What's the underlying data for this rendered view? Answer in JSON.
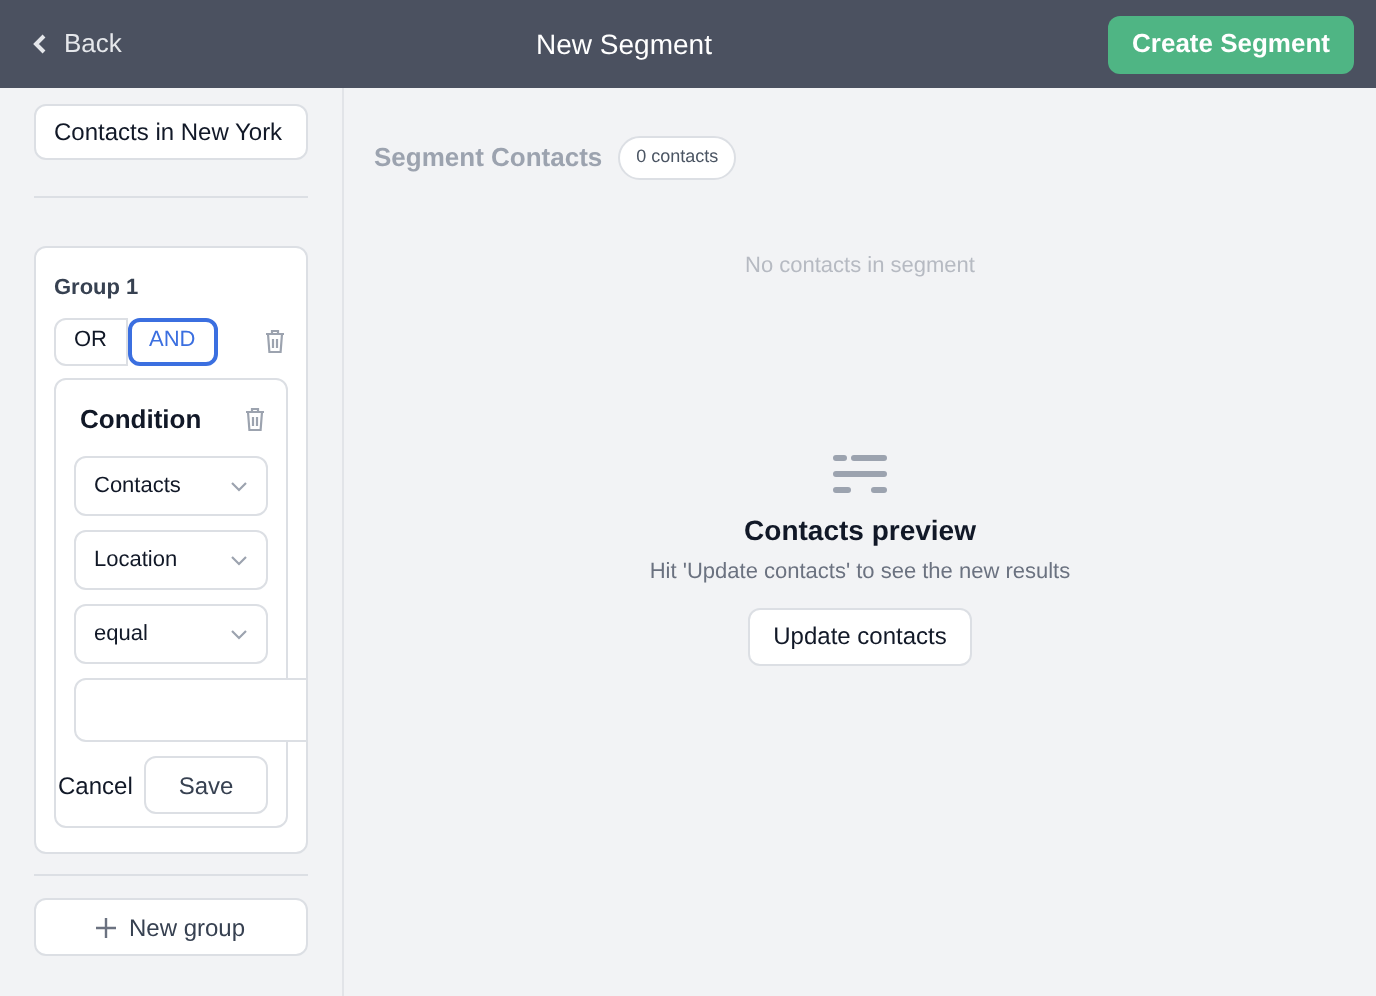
{
  "header": {
    "back": "Back",
    "title": "New Segment",
    "action": "Create Segment"
  },
  "sidebar": {
    "segment_name": "Contacts in New York",
    "group": {
      "title": "Group 1",
      "operators": [
        {
          "label": "OR",
          "selected": false
        },
        {
          "label": "AND",
          "selected": true
        }
      ],
      "condition": {
        "title": "Condition",
        "selects": [
          "Contacts",
          "Location",
          "equal"
        ],
        "cancel": "Cancel",
        "save": "Save"
      }
    },
    "new_group": "New group"
  },
  "main": {
    "title": "Segment Contacts",
    "count": "0 contacts",
    "empty": "No contacts in segment",
    "preview_title": "Contacts preview",
    "preview_hint": "Hit 'Update contacts' to see the new results",
    "update": "Update contacts"
  }
}
